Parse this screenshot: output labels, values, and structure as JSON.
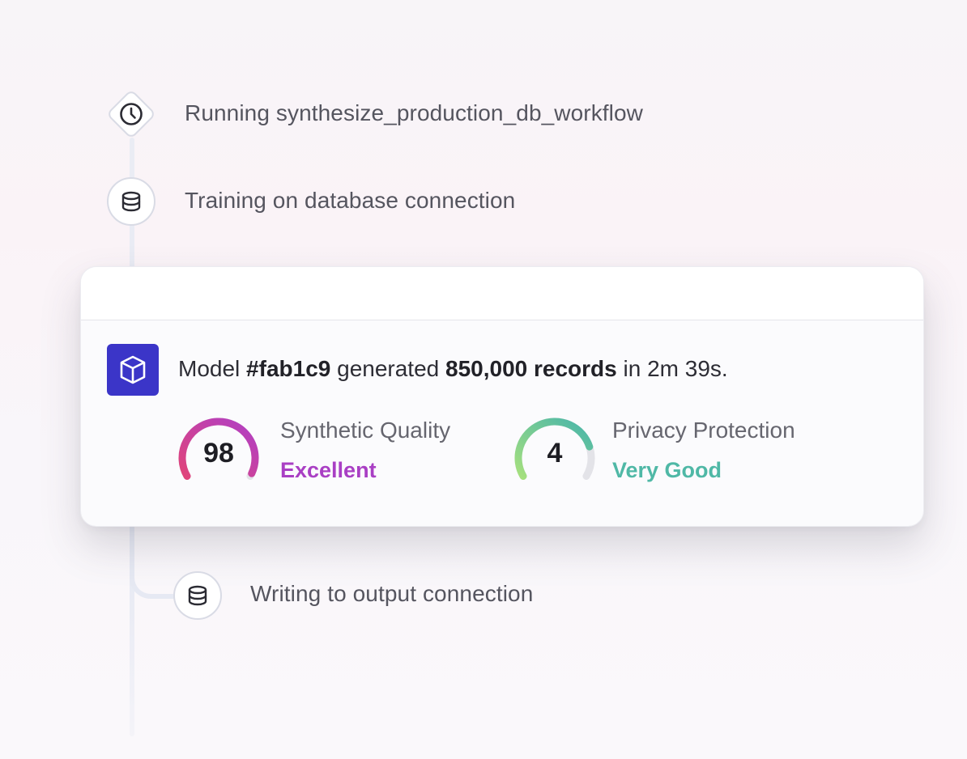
{
  "steps": {
    "running": {
      "label": "Running synthesize_production_db_workflow",
      "icon": "clock-icon"
    },
    "training": {
      "label": "Training on database connection",
      "icon": "database-icon"
    },
    "writing": {
      "label": "Writing to output connection",
      "icon": "database-icon"
    }
  },
  "result_card": {
    "icon": "cube-icon",
    "summary": {
      "prefix": "Model ",
      "model_id": "#fab1c9",
      "mid": " generated ",
      "records": "850,000 records",
      "suffix": " in 2m 39s."
    },
    "metrics": [
      {
        "title": "Synthetic Quality",
        "value": "98",
        "rating": "Excellent",
        "level": 0.98,
        "color": "#a93fc4",
        "gradient": [
          "#e0457a",
          "#b03fc6"
        ]
      },
      {
        "title": "Privacy Protection",
        "value": "4",
        "rating": "Very Good",
        "level": 0.8,
        "color": "#4fb8a6",
        "gradient": [
          "#a6e07e",
          "#48b5aa"
        ]
      }
    ]
  }
}
